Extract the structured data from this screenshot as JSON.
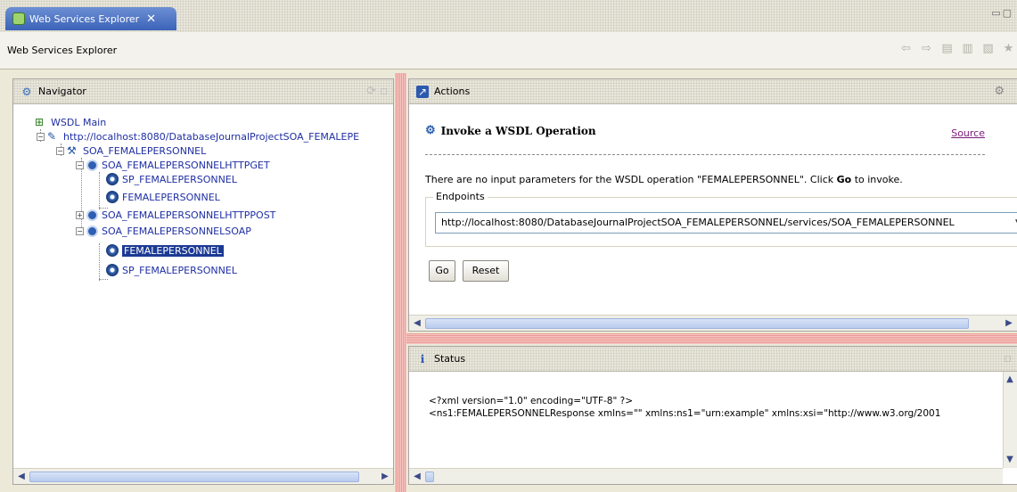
{
  "tab": {
    "title": "Web Services Explorer",
    "close": "✕"
  },
  "header": {
    "title": "Web Services Explorer"
  },
  "navigator": {
    "title": "Navigator",
    "tree": [
      {
        "label": "WSDL Main"
      },
      {
        "label": "http://localhost:8080/DatabaseJournalProjectSOA_FEMALEPE"
      },
      {
        "label": "SOA_FEMALEPERSONNEL"
      },
      {
        "label": "SOA_FEMALEPERSONNELHTTPGET"
      },
      {
        "label": "SP_FEMALEPERSONNEL"
      },
      {
        "label": "FEMALEPERSONNEL"
      },
      {
        "label": "SOA_FEMALEPERSONNELHTTPPOST"
      },
      {
        "label": "SOA_FEMALEPERSONNELSOAP"
      },
      {
        "label": "FEMALEPERSONNEL"
      },
      {
        "label": "SP_FEMALEPERSONNEL"
      }
    ]
  },
  "actions": {
    "title": "Actions",
    "invoke_title": "Invoke a WSDL Operation",
    "source_link": "Source",
    "message_pre": "There are no input parameters for the WSDL operation \"FEMALEPERSONNEL\". Click ",
    "message_go": "Go",
    "message_post": " to invoke.",
    "endpoints_label": "Endpoints",
    "endpoint_value": "http://localhost:8080/DatabaseJournalProjectSOA_FEMALEPERSONNEL/services/SOA_FEMALEPERSONNEL",
    "go_label": "Go",
    "reset_label": "Reset"
  },
  "status": {
    "title": "Status",
    "line1": "<?xml version=\"1.0\" encoding=\"UTF-8\" ?>",
    "line2": "<ns1:FEMALEPERSONNELResponse xmlns=\"\" xmlns:ns1=\"urn:example\" xmlns:xsi=\"http://www.w3.org/2001"
  }
}
